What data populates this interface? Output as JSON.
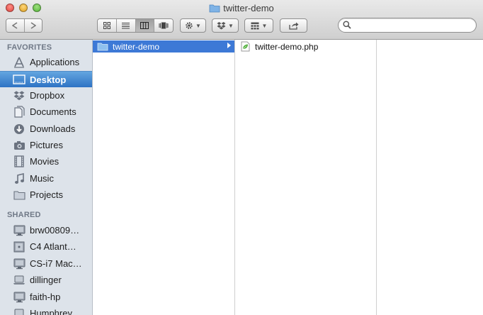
{
  "window": {
    "title": "twitter-demo"
  },
  "toolbar": {
    "search": {
      "value": "",
      "placeholder": ""
    }
  },
  "sidebar": {
    "favorites_header": "FAVORITES",
    "favorites": [
      {
        "label": "Applications",
        "icon": "applications-icon"
      },
      {
        "label": "Desktop",
        "icon": "desktop-icon",
        "selected": true
      },
      {
        "label": "Dropbox",
        "icon": "dropbox-icon"
      },
      {
        "label": "Documents",
        "icon": "documents-icon"
      },
      {
        "label": "Downloads",
        "icon": "downloads-icon"
      },
      {
        "label": "Pictures",
        "icon": "pictures-icon"
      },
      {
        "label": "Movies",
        "icon": "movies-icon"
      },
      {
        "label": "Music",
        "icon": "music-icon"
      },
      {
        "label": "Projects",
        "icon": "folder-icon"
      }
    ],
    "shared_header": "SHARED",
    "shared": [
      {
        "label": "brw00809…",
        "icon": "computer-icon"
      },
      {
        "label": "C4 Atlant…",
        "icon": "server-icon"
      },
      {
        "label": "CS-i7 Mac…",
        "icon": "computer-icon"
      },
      {
        "label": "dillinger",
        "icon": "laptop-icon"
      },
      {
        "label": "faith-hp",
        "icon": "computer-icon"
      },
      {
        "label": "Humphrey",
        "icon": "laptop-icon"
      }
    ]
  },
  "columns": [
    {
      "items": [
        {
          "label": "twitter-demo",
          "icon": "folder-icon",
          "selected": true
        }
      ]
    },
    {
      "items": [
        {
          "label": "twitter-demo.php",
          "icon": "php-file-icon"
        }
      ]
    },
    {
      "items": []
    }
  ],
  "colors": {
    "selection": "#3d79d6",
    "sidebar_bg": "#dde3ea",
    "sidebar_selection": "#2e73c4"
  }
}
